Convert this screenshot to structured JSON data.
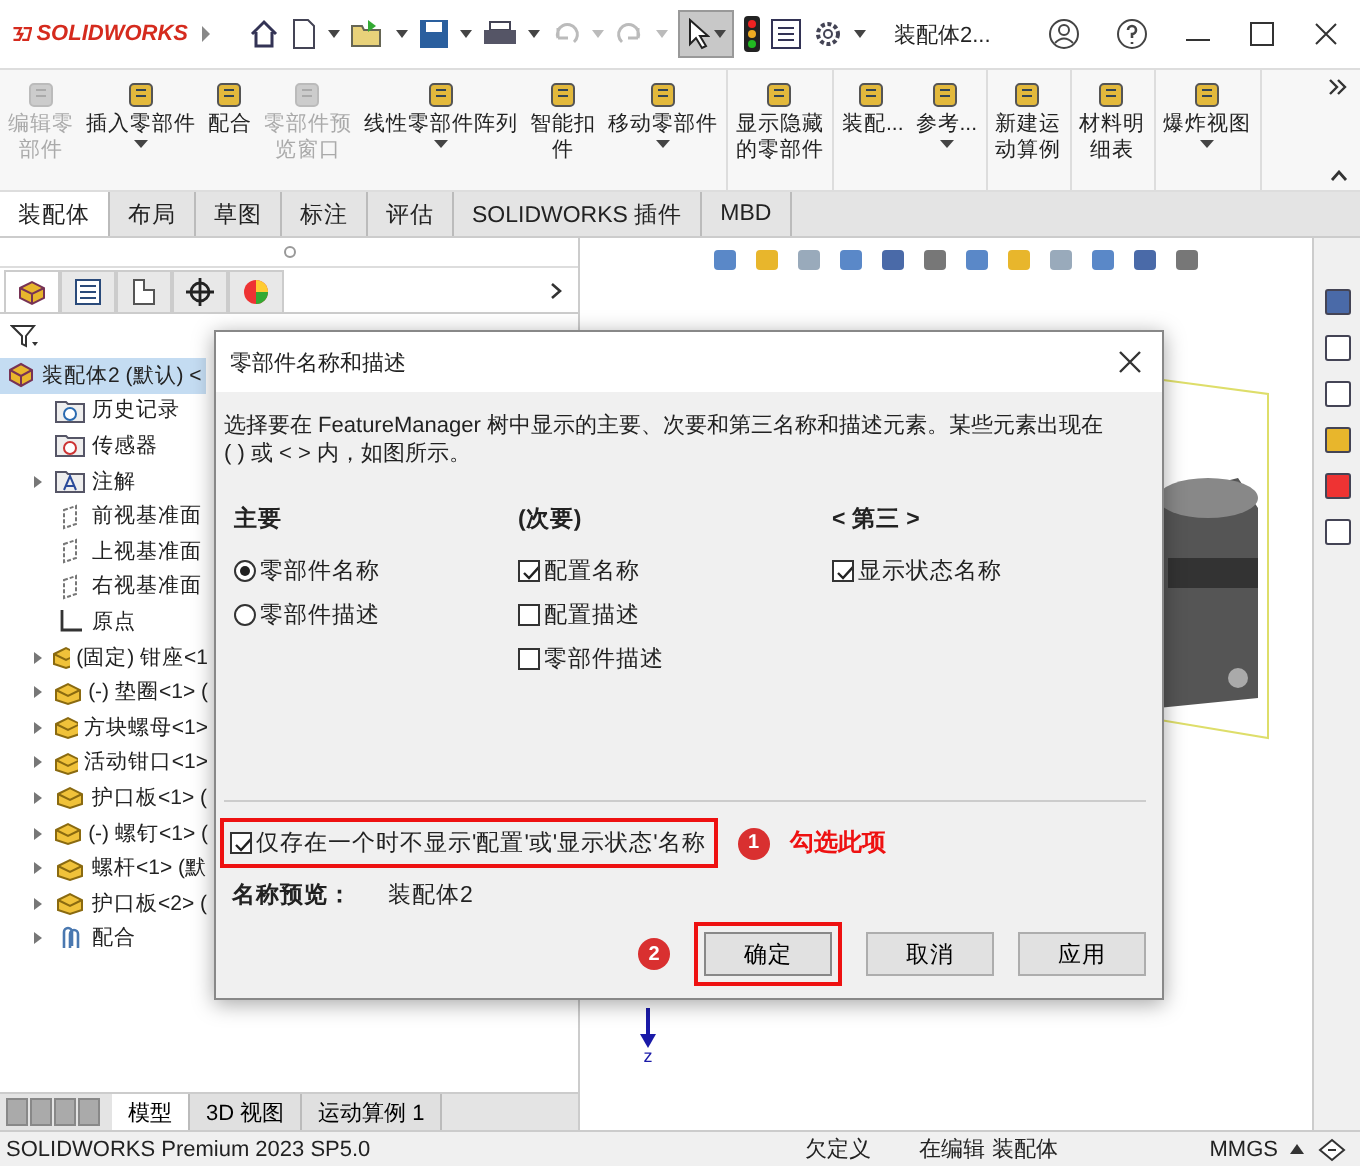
{
  "title_bar": {
    "logo": "SOLIDWORKS",
    "document": "装配体2..."
  },
  "ribbon": {
    "groups": [
      [
        {
          "label_lines": [
            "编辑零",
            "部件"
          ],
          "disabled": true,
          "dropdown": false
        },
        {
          "label_lines": [
            "插入零部件"
          ],
          "disabled": false,
          "dropdown": true
        },
        {
          "label_lines": [
            "配合"
          ],
          "disabled": false,
          "dropdown": false
        },
        {
          "label_lines": [
            "零部件预",
            "览窗口"
          ],
          "disabled": true,
          "dropdown": false
        },
        {
          "label_lines": [
            "线性零部件阵列"
          ],
          "disabled": false,
          "dropdown": true
        },
        {
          "label_lines": [
            "智能扣",
            "件"
          ],
          "disabled": false,
          "dropdown": false
        },
        {
          "label_lines": [
            "移动零部件"
          ],
          "disabled": false,
          "dropdown": true
        }
      ],
      [
        {
          "label_lines": [
            "显示隐藏",
            "的零部件"
          ],
          "disabled": false,
          "dropdown": false
        }
      ],
      [
        {
          "label_lines": [
            "装配..."
          ],
          "disabled": false,
          "dropdown": false
        },
        {
          "label_lines": [
            "参考..."
          ],
          "disabled": false,
          "dropdown": true
        }
      ],
      [
        {
          "label_lines": [
            "新建运",
            "动算例"
          ],
          "disabled": false,
          "dropdown": false
        }
      ],
      [
        {
          "label_lines": [
            "材料明",
            "细表"
          ],
          "disabled": false,
          "dropdown": false
        }
      ],
      [
        {
          "label_lines": [
            "爆炸视图"
          ],
          "disabled": false,
          "dropdown": true
        }
      ]
    ]
  },
  "command_tabs": [
    {
      "label": "装配体",
      "selected": true
    },
    {
      "label": "布局",
      "selected": false
    },
    {
      "label": "草图",
      "selected": false
    },
    {
      "label": "标注",
      "selected": false
    },
    {
      "label": "评估",
      "selected": false
    },
    {
      "label": "SOLIDWORKS 插件",
      "selected": false
    },
    {
      "label": "MBD",
      "selected": false
    }
  ],
  "panel_tabs": [
    {
      "selected": true
    },
    {
      "selected": false
    },
    {
      "selected": false
    },
    {
      "selected": false
    },
    {
      "selected": false
    }
  ],
  "tree": {
    "label": "装配体2 (默认) <",
    "selected": true,
    "children": [
      {
        "kind": "history",
        "label": "历史记录",
        "expandable": false,
        "selected": false
      },
      {
        "kind": "sensor",
        "label": "传感器",
        "expandable": false,
        "selected": false
      },
      {
        "kind": "annotation",
        "label": "注解",
        "expandable": true,
        "selected": false
      },
      {
        "kind": "plane",
        "label": "前视基准面",
        "expandable": false,
        "selected": false
      },
      {
        "kind": "plane",
        "label": "上视基准面",
        "expandable": false,
        "selected": false
      },
      {
        "kind": "plane",
        "label": "右视基准面",
        "expandable": false,
        "selected": false
      },
      {
        "kind": "origin",
        "label": "原点",
        "expandable": false,
        "selected": false
      },
      {
        "kind": "part",
        "label": "(固定) 钳座<1",
        "expandable": true,
        "selected": false
      },
      {
        "kind": "part",
        "label": "(-) 垫圈<1> (",
        "expandable": true,
        "selected": false
      },
      {
        "kind": "part",
        "label": "方块螺母<1>",
        "expandable": true,
        "selected": false
      },
      {
        "kind": "part",
        "label": "活动钳口<1>",
        "expandable": true,
        "selected": false
      },
      {
        "kind": "part",
        "label": "护口板<1> (",
        "expandable": true,
        "selected": false
      },
      {
        "kind": "part",
        "label": "(-) 螺钉<1> (",
        "expandable": true,
        "selected": false
      },
      {
        "kind": "part",
        "label": "螺杆<1> (默",
        "expandable": true,
        "selected": false
      },
      {
        "kind": "part",
        "label": "护口板<2> (",
        "expandable": true,
        "selected": false
      },
      {
        "kind": "mates",
        "label": "配合",
        "expandable": true,
        "selected": false
      }
    ]
  },
  "graphics": {
    "axis_label": "z"
  },
  "bottom_tabs": [
    {
      "label": "模型",
      "selected": true
    },
    {
      "label": "3D 视图",
      "selected": false
    },
    {
      "label": "运动算例 1",
      "selected": false
    }
  ],
  "status_bar": {
    "product": "SOLIDWORKS Premium 2023 SP5.0",
    "state": "欠定义",
    "mode": "在编辑 装配体",
    "units": "MMGS"
  },
  "dialog": {
    "title": "零部件名称和描述",
    "description": "选择要在 FeatureManager 树中显示的主要、次要和第三名称和描述元素。某些元素出现在 ( ) 或 < > 内，如图所示。",
    "columns": [
      {
        "heading": "主要",
        "options": [
          {
            "kind": "radio",
            "label": "零部件名称",
            "selected": true
          },
          {
            "kind": "radio",
            "label": "零部件描述",
            "selected": false
          }
        ]
      },
      {
        "heading": "(次要)",
        "options": [
          {
            "kind": "checkbox",
            "label": "配置名称",
            "checked": true
          },
          {
            "kind": "checkbox",
            "label": "配置描述",
            "checked": false
          },
          {
            "kind": "checkbox",
            "label": "零部件描述",
            "checked": false
          }
        ]
      },
      {
        "heading": "< 第三 >",
        "options": [
          {
            "kind": "checkbox",
            "label": "显示状态名称",
            "checked": true
          }
        ]
      }
    ],
    "suppress_option": {
      "label": "仅存在一个时不显示'配置'或'显示状态'名称",
      "checked": true
    },
    "preview_label": "名称预览：",
    "preview_value": "装配体2",
    "buttons": [
      {
        "label": "确定",
        "default": true
      },
      {
        "label": "取消",
        "default": false
      },
      {
        "label": "应用",
        "default": false
      }
    ]
  },
  "annotations": [
    {
      "number": "1",
      "text": "勾选此项"
    },
    {
      "number": "2"
    }
  ]
}
